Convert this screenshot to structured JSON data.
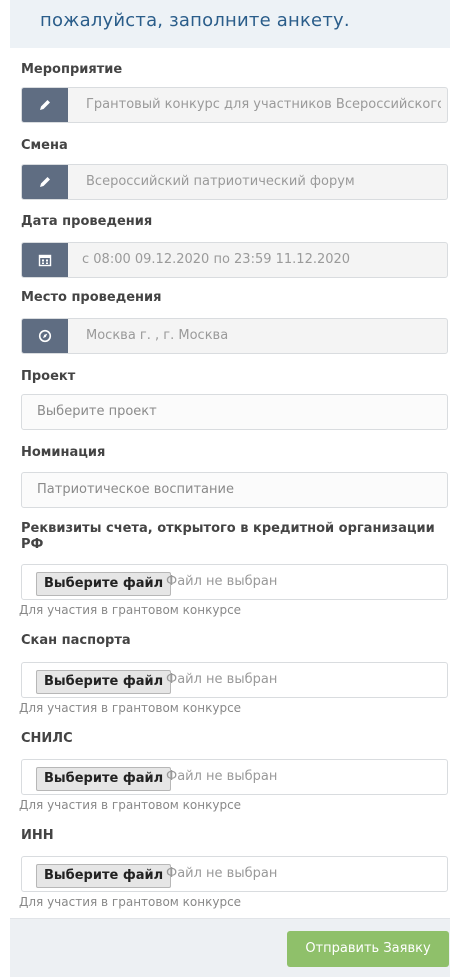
{
  "header": {
    "title": "пожалуйста, заполните анкету."
  },
  "fields": {
    "event": {
      "label": "Мероприятие",
      "value": "Грантовый конкурс для участников Всероссийскогс",
      "icon": "pencil-icon"
    },
    "shift": {
      "label": "Смена",
      "value": "Всероссийский патриотический форум",
      "icon": "pencil-icon"
    },
    "date": {
      "label": "Дата проведения",
      "value": "с 08:00 09.12.2020 по 23:59 11.12.2020",
      "icon": "calendar-icon"
    },
    "place": {
      "label": "Место проведения",
      "value": "Москва г. , г. Москва",
      "icon": "location-icon"
    },
    "project": {
      "label": "Проект",
      "placeholder": "Выберите проект"
    },
    "nomination": {
      "label": "Номинация",
      "value": "Патриотическое воспитание"
    }
  },
  "uploads": [
    {
      "label": "Реквизиты счета, открытого в кредитной организации РФ",
      "button": "Выберите файл",
      "status": "Файл не выбран",
      "hint": "Для участия в грантовом конкурсе"
    },
    {
      "label": "Скан паспорта",
      "button": "Выберите файл",
      "status": "Файл не выбран",
      "hint": "Для участия в грантовом конкурсе"
    },
    {
      "label": "СНИЛС",
      "button": "Выберите файл",
      "status": "Файл не выбран",
      "hint": "Для участия в грантовом конкурсе"
    },
    {
      "label": "ИНН",
      "button": "Выберите файл",
      "status": "Файл не выбран",
      "hint": "Для участия в грантовом конкурсе"
    }
  ],
  "footer": {
    "submit_label": "Отправить Заявку"
  },
  "colors": {
    "icon_bg": "#5f6d82",
    "submit_bg": "#8fc06a",
    "header_text": "#2a5d8a"
  }
}
